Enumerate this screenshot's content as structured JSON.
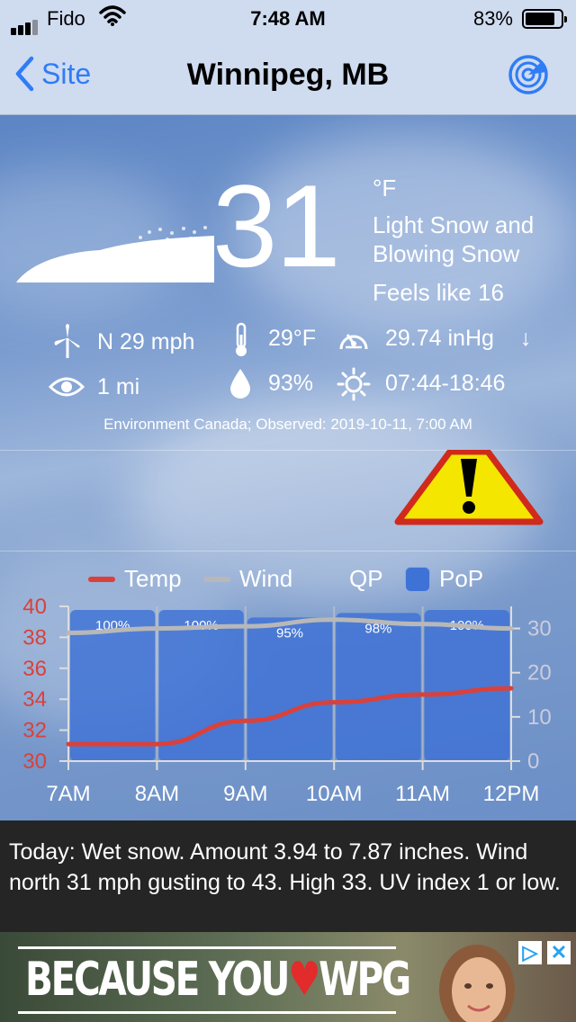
{
  "status_bar": {
    "carrier": "Fido",
    "time": "7:48 AM",
    "battery": "83%",
    "battery_level": 0.83,
    "signal_bars": 3
  },
  "nav": {
    "back_label": "Site",
    "title": "Winnipeg, MB"
  },
  "current": {
    "temperature": "31",
    "unit": "°F",
    "condition": "Light Snow and Blowing Snow",
    "feels_like": "Feels like 16"
  },
  "stats": {
    "wind": "N 29 mph",
    "dewpoint": "29°F",
    "pressure": "29.74 inHg",
    "pressure_trend": "↓",
    "visibility": "1 mi",
    "humidity": "93%",
    "sun": "07:44-18:46"
  },
  "source": "Environment Canada; Observed: 2019-10-11, 7:00 AM",
  "legend": {
    "temp": "Temp",
    "wind": "Wind",
    "qp": "QP",
    "pop": "PoP"
  },
  "colors": {
    "temp": "#d9413b",
    "wind": "#b8b8b8",
    "pop": "#3e72d6",
    "accent": "#2f7cf6"
  },
  "chart_data": {
    "type": "line",
    "x": [
      "7AM",
      "8AM",
      "9AM",
      "10AM",
      "11AM",
      "12PM"
    ],
    "y_left_ticks": [
      "40",
      "38",
      "36",
      "34",
      "32",
      "30"
    ],
    "y_right_ticks": [
      "30",
      "20",
      "10",
      "0"
    ],
    "ylim_left": [
      30,
      40
    ],
    "ylim_right": [
      0,
      35
    ],
    "series": [
      {
        "name": "Temp",
        "axis": "left",
        "values": [
          31.1,
          31.1,
          32.6,
          33.8,
          34.3,
          34.7
        ]
      },
      {
        "name": "Wind",
        "axis": "right",
        "values": [
          29,
          30,
          30.5,
          32,
          31,
          30
        ]
      },
      {
        "name": "PoP",
        "type": "bar",
        "values": [
          100,
          100,
          95,
          98,
          100
        ],
        "labels": [
          "100%",
          "100%",
          "95%",
          "98%",
          "100%"
        ]
      }
    ]
  },
  "forecast": "Today:  Wet snow. Amount 3.94 to 7.87 inches. Wind north 31 mph gusting to 43. High 33. UV index 1 or low.",
  "ad": {
    "text": "BECAUSE YOU",
    "heart": "♥",
    "text2": "WPG",
    "badge_play": "▷",
    "badge_close": "✕"
  }
}
